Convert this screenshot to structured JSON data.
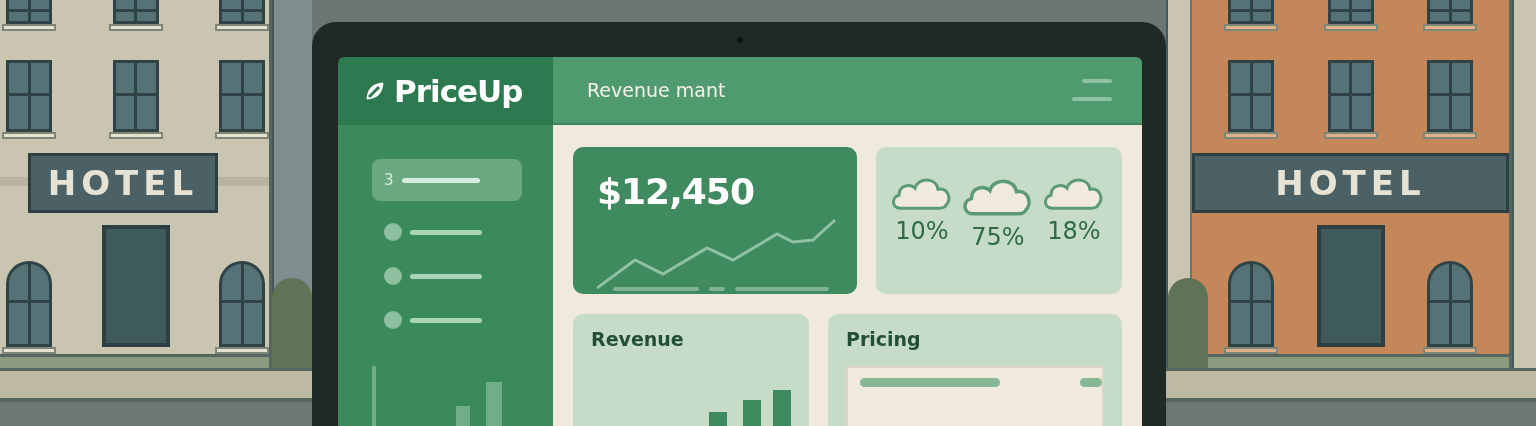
{
  "scene": {
    "left_building": {
      "sign": "HOTEL"
    },
    "right_building": {
      "sign": "HOTEL"
    }
  },
  "app": {
    "logo": "PriceUp",
    "header_title": "Revenue mant",
    "sidebar": {
      "items": [
        {
          "kind": "glyph",
          "glyph": "3",
          "selected": true
        },
        {
          "kind": "dot",
          "selected": false
        },
        {
          "kind": "dot",
          "selected": false
        },
        {
          "kind": "dot",
          "selected": false
        }
      ]
    },
    "revenue_card": {
      "amount": "$12,450"
    },
    "weather_card": {
      "readings": [
        "10%",
        "75%",
        "18%"
      ]
    },
    "revenue_panel": {
      "title": "Revenue"
    },
    "pricing_panel": {
      "title": "Pricing"
    }
  }
}
